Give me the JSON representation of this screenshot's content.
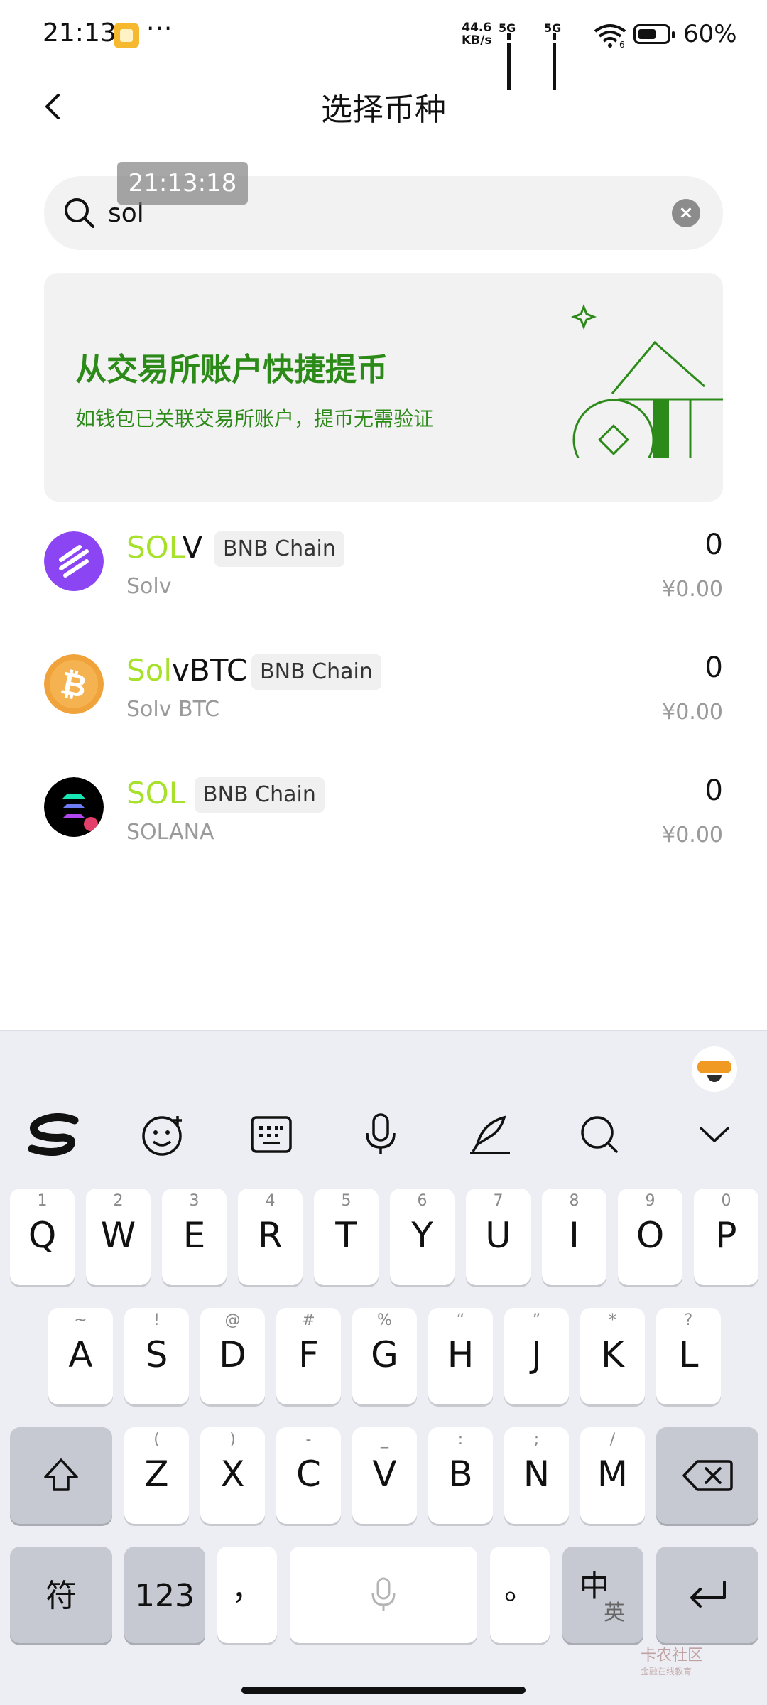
{
  "status_bar": {
    "time": "21:13",
    "more": "···",
    "net_rate_value": "44.6",
    "net_rate_unit": "KB/s",
    "signal1_label": "5G",
    "signal2_label": "5G",
    "wifi_badge": "6",
    "battery_percent": "60%",
    "battery_level": 0.6
  },
  "header": {
    "title": "选择币种"
  },
  "search": {
    "value": "sol",
    "placeholder": ""
  },
  "overlay_time": "21:13:18",
  "banner": {
    "title": "从交易所账户快捷提币",
    "subtitle": "如钱包已关联交易所账户，提币无需验证",
    "accent": "#2c8a19"
  },
  "tokens": [
    {
      "symbol_match": "SOL",
      "symbol_rest": "V",
      "chain": "BNB Chain",
      "name": "Solv",
      "amount": "0",
      "fiat": "¥0.00",
      "icon": "solv-token-icon"
    },
    {
      "symbol_match": "Sol",
      "symbol_rest": "vBTC",
      "chain": "BNB Chain",
      "name": "Solv BTC",
      "amount": "0",
      "fiat": "¥0.00",
      "icon": "bitcoin-token-icon"
    },
    {
      "symbol_match": "SOL",
      "symbol_rest": "",
      "chain": "BNB Chain",
      "name": "SOLANA",
      "amount": "0",
      "fiat": "¥0.00",
      "icon": "solana-token-icon"
    }
  ],
  "highlight_color": "#a7e12c",
  "keyboard": {
    "toolbar": [
      "sogou-logo-icon",
      "emoji-icon",
      "keyboard-icon",
      "microphone-icon",
      "handwriting-icon",
      "search-icon",
      "chevron-down-icon"
    ],
    "row1": [
      {
        "main": "Q",
        "hint": "1"
      },
      {
        "main": "W",
        "hint": "2"
      },
      {
        "main": "E",
        "hint": "3"
      },
      {
        "main": "R",
        "hint": "4"
      },
      {
        "main": "T",
        "hint": "5"
      },
      {
        "main": "Y",
        "hint": "6"
      },
      {
        "main": "U",
        "hint": "7"
      },
      {
        "main": "I",
        "hint": "8"
      },
      {
        "main": "O",
        "hint": "9"
      },
      {
        "main": "P",
        "hint": "0"
      }
    ],
    "row2": [
      {
        "main": "A",
        "hint": "~"
      },
      {
        "main": "S",
        "hint": "!"
      },
      {
        "main": "D",
        "hint": "@"
      },
      {
        "main": "F",
        "hint": "#"
      },
      {
        "main": "G",
        "hint": "%"
      },
      {
        "main": "H",
        "hint": "“"
      },
      {
        "main": "J",
        "hint": "”"
      },
      {
        "main": "K",
        "hint": "*"
      },
      {
        "main": "L",
        "hint": "?"
      }
    ],
    "row3": [
      {
        "main": "Z",
        "hint": "("
      },
      {
        "main": "X",
        "hint": ")"
      },
      {
        "main": "C",
        "hint": "-"
      },
      {
        "main": "V",
        "hint": "_"
      },
      {
        "main": "B",
        "hint": ":"
      },
      {
        "main": "N",
        "hint": ";"
      },
      {
        "main": "M",
        "hint": "/"
      }
    ],
    "symbols_key": "符",
    "numbers_key": "123",
    "comma_key": "，",
    "period_key": "。",
    "lang_key_main": "中",
    "lang_key_alt": "英"
  },
  "watermark": {
    "text": "卡农社区",
    "sub": "金融在线教育"
  }
}
